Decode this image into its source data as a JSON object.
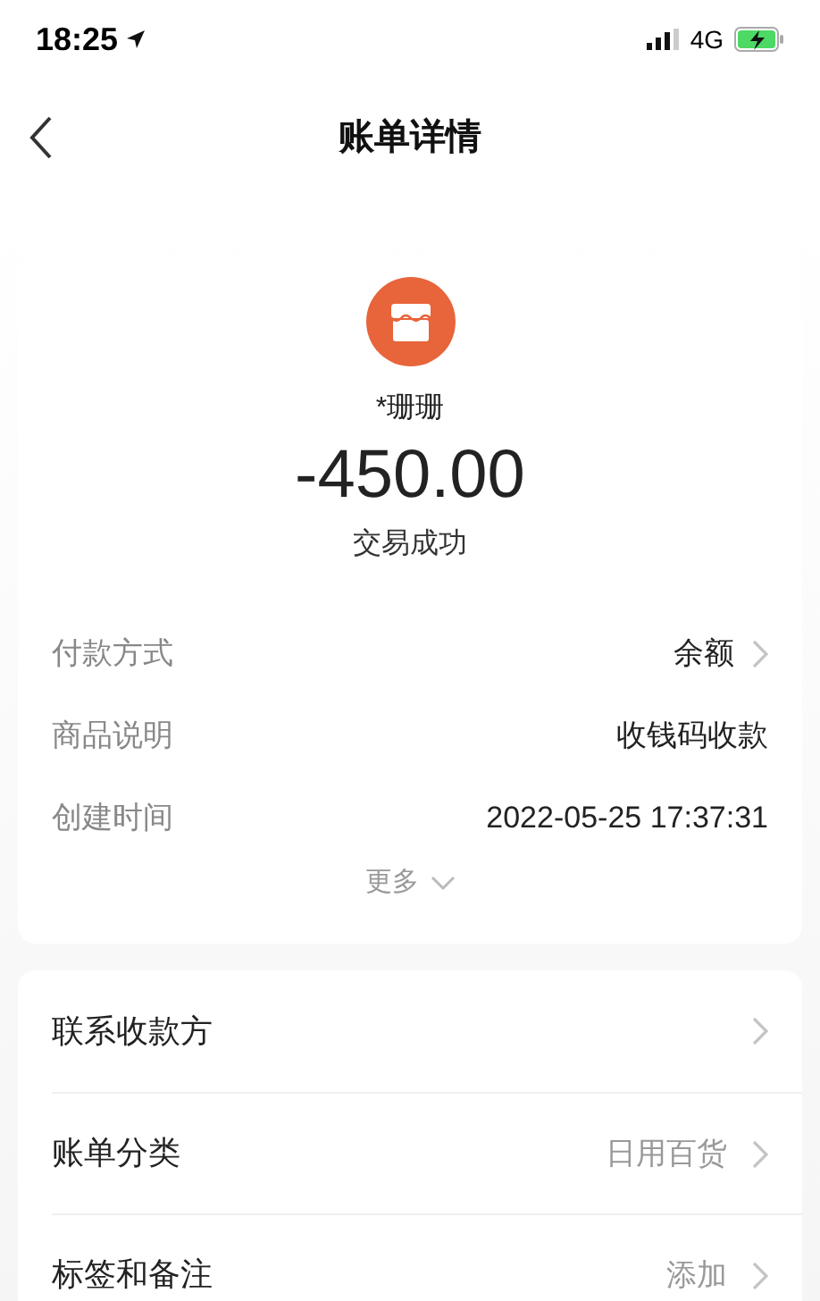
{
  "status_bar": {
    "time": "18:25",
    "network": "4G"
  },
  "header": {
    "title": "账单详情"
  },
  "summary": {
    "payee": "*珊珊",
    "amount": "-450.00",
    "status": "交易成功"
  },
  "details": [
    {
      "label": "付款方式",
      "value": "余额",
      "arrow": true
    },
    {
      "label": "商品说明",
      "value": "收钱码收款",
      "arrow": false
    },
    {
      "label": "创建时间",
      "value": "2022-05-25 17:37:31",
      "arrow": false
    }
  ],
  "more": {
    "label": "更多"
  },
  "actions": [
    {
      "label": "联系收款方"
    },
    {
      "label": "账单分类",
      "value": "日用百货"
    },
    {
      "label": "标签和备注",
      "value": "添加"
    }
  ]
}
